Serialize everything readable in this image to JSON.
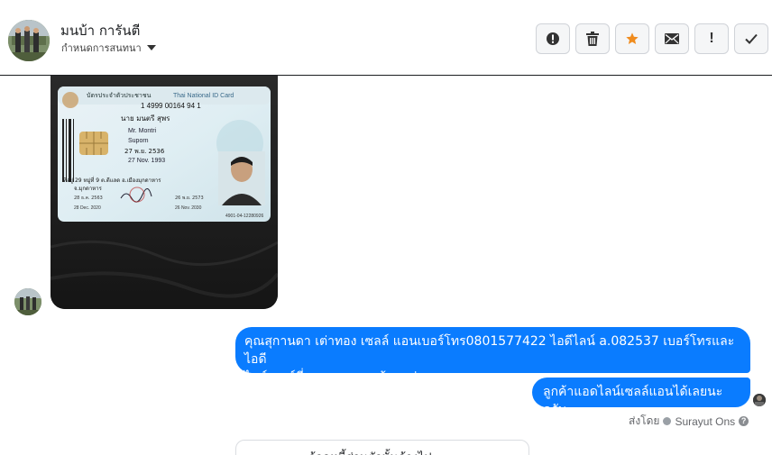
{
  "header": {
    "contact_name": "มนบ้า การันตี",
    "assign_label": "กำหนดการสนทนา"
  },
  "actions": [
    {
      "name": "report-spam",
      "icon": "alert-circle-icon"
    },
    {
      "name": "delete",
      "icon": "trash-icon"
    },
    {
      "name": "star",
      "icon": "star-icon"
    },
    {
      "name": "mark-unread",
      "icon": "envelope-icon"
    },
    {
      "name": "follow-up",
      "icon": "exclamation-icon",
      "label": "!"
    },
    {
      "name": "done",
      "icon": "check-icon"
    }
  ],
  "id_card": {
    "title_th": "บัตรประจำตัวประชาชน",
    "title_en": "Thai National ID Card",
    "id_number": "1 4999 00164 94 1",
    "name_th": "นาย มนตรี สุพร",
    "name_en": "Mr. Montri",
    "last_name_en": "Suporn",
    "dob_th": "27 พ.ย. 2536",
    "dob_en": "27 Nov. 1993",
    "address": "ที่อยู่ 29 หมู่ที่ 9 ต.ดีแลด อ.เมืองมุกดาหาร",
    "province": "จ.มุกดาหาร",
    "issue_th": "28 ธ.ค. 2563",
    "issue_en": "28 Dec. 2020",
    "expiry_th": "26 พ.ย. 2573",
    "expiry_en": "26 Nov. 2030",
    "serial": "4901-04-12280926"
  },
  "messages": {
    "bubble1_line1": "คุณสุกานดา เต่าทอง  เซลล์ แอนเบอร์โทร0801577422 ไอดีไลน์ a.082537  เบอร์โทรและไอดี",
    "bubble1_line2": "ไลน์เซลล์ที่จะดูแลคุณลูกค้านะค่ะ",
    "bubble2": "ลูกค้าแอดไลน์เซลล์แอนได้เลยนะครับ",
    "sent_by_prefix": "ส่งโดย",
    "sender": "Surayut Ons",
    "help": "?",
    "bottom_card": "ล้อดหนี้ส่วนตัวนั้นค้างไป"
  },
  "colors": {
    "bubble": "#0a7cff",
    "star": "#f08c1e",
    "icon": "#333333"
  }
}
